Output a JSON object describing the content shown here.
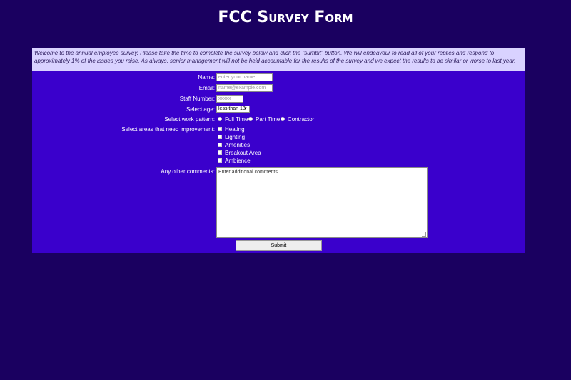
{
  "page": {
    "title": "FCC Survey Form",
    "intro": "Welcome to the annual employee survey. Please take the time to complete the survey below and click the \"sumbit\" button. We will endeavour to read all of your replies and respond to approximately 1% of the issues you raise. As always, senior management will not be held accountable for the results of the survey and we expect the results to be similar or worse to last year."
  },
  "form": {
    "name": {
      "label": "Name:",
      "placeholder": "enter your name"
    },
    "email": {
      "label": "Email:",
      "placeholder": "name@example.com"
    },
    "staff_number": {
      "label": "Staff Number:",
      "placeholder": "xxxxx"
    },
    "age": {
      "label": "Select age:",
      "selected": "less than 18"
    },
    "work_pattern": {
      "label": "Select work pattern:",
      "options": [
        "Full Time",
        "Part Time",
        "Contractor"
      ]
    },
    "improvements": {
      "label": "Select areas that need improvement:",
      "options": [
        "Heating",
        "Lighting",
        "Amenities",
        "Breakout Area",
        "Ambience"
      ]
    },
    "comments": {
      "label": "Any other comments:",
      "placeholder": "Enter additional comments"
    },
    "submit_label": "Submit"
  },
  "colors": {
    "background": "#1a0060",
    "panel": "#3a00cc",
    "intro_bg": "#d9d2ff"
  }
}
